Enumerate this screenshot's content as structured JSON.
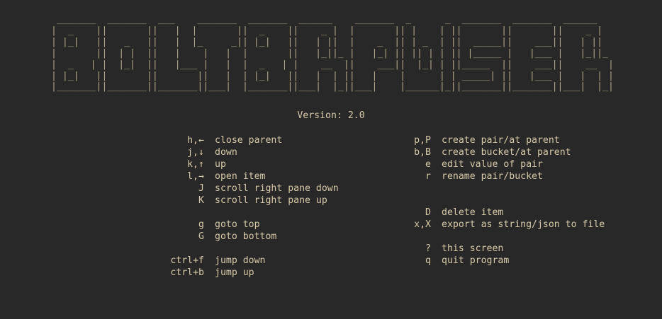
{
  "logo_ascii": " _______  _______  ___    _______  _______  ______    _______  _      _  _______  _______  ______\n|  _    ||       ||   |  |       ||  _    ||    _ |  |       || |    | ||       ||       ||    _ |\n| |_|   ||   _   ||   |  |_     _|| |_|   ||   | ||  |    _  || | _  | ||  _____||    ___||   | ||\n|       ||  | |  ||   |    |   |  |       ||   |_||_ |   |_| || || | | || |_____ |   |___ |   |_||_\n|  _   | |  |_|  ||   |___ |   |  |  _   | |    __  ||    ___||  |_| | ||_____  ||    ___||    __  |\n| |_|   ||       ||       ||   |  | |_|   ||   |  | ||   |    |      | | _____| ||   |___ |   |  | |\n|_______||_______||_______||___|  |_______||___|  |_||___|    |______|_||_______||_______||___|  |_|",
  "version_text": "Version: 2.0",
  "left_keys": [
    {
      "key": "h,←",
      "desc": "close parent"
    },
    {
      "key": "j,↓",
      "desc": "down"
    },
    {
      "key": "k,↑",
      "desc": "up"
    },
    {
      "key": "l,→",
      "desc": "open item"
    },
    {
      "key": "J",
      "desc": "scroll right pane down"
    },
    {
      "key": "K",
      "desc": "scroll right pane up"
    },
    {
      "key": "",
      "desc": ""
    },
    {
      "key": "g",
      "desc": "goto top"
    },
    {
      "key": "G",
      "desc": "goto bottom"
    },
    {
      "key": "",
      "desc": ""
    },
    {
      "key": "ctrl+f",
      "desc": "jump down"
    },
    {
      "key": "ctrl+b",
      "desc": "jump up"
    }
  ],
  "right_keys": [
    {
      "key": "p,P",
      "desc": "create pair/at parent"
    },
    {
      "key": "b,B",
      "desc": "create bucket/at parent"
    },
    {
      "key": "e",
      "desc": "edit value of pair"
    },
    {
      "key": "r",
      "desc": "rename pair/bucket"
    },
    {
      "key": "",
      "desc": ""
    },
    {
      "key": "",
      "desc": ""
    },
    {
      "key": "D",
      "desc": "delete item"
    },
    {
      "key": "x,X",
      "desc": "export as string/json to file"
    },
    {
      "key": "",
      "desc": ""
    },
    {
      "key": "?",
      "desc": "this screen"
    },
    {
      "key": "q",
      "desc": "quit program"
    }
  ],
  "colors": {
    "background": "#282828",
    "text": "#d8c9a8",
    "logo": "#b0a386"
  }
}
